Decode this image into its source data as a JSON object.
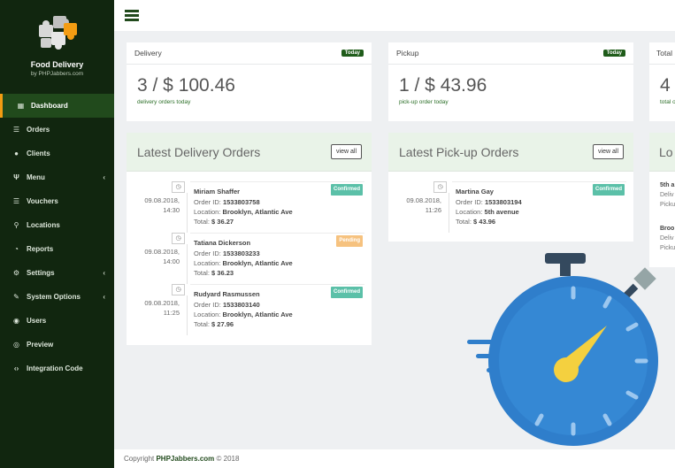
{
  "brand": {
    "title": "Food Delivery",
    "subtitle": "by PHPJabbers.com"
  },
  "nav": [
    {
      "label": "Dashboard",
      "icon": "dashboard-icon",
      "active": true
    },
    {
      "label": "Orders",
      "icon": "list-icon"
    },
    {
      "label": "Clients",
      "icon": "user-icon"
    },
    {
      "label": "Menu",
      "icon": "cutlery-icon",
      "chevron": true
    },
    {
      "label": "Vouchers",
      "icon": "list-icon"
    },
    {
      "label": "Locations",
      "icon": "map-marker-icon"
    },
    {
      "label": "Reports",
      "icon": "chart-icon"
    },
    {
      "label": "Settings",
      "icon": "gears-icon",
      "chevron": true
    },
    {
      "label": "System Options",
      "icon": "wrench-icon",
      "chevron": true
    },
    {
      "label": "Users",
      "icon": "users-icon"
    },
    {
      "label": "Preview",
      "icon": "eye-icon"
    },
    {
      "label": "Integration Code",
      "icon": "code-icon"
    }
  ],
  "stats": {
    "delivery": {
      "title": "Delivery",
      "badge": "Today",
      "value": "3 / $ 100.46",
      "sub": "delivery orders today"
    },
    "pickup": {
      "title": "Pickup",
      "badge": "Today",
      "value": "1 / $ 43.96",
      "sub": "pick-up order today"
    },
    "total": {
      "title": "Total",
      "value": "4",
      "sub": "total o"
    }
  },
  "delivery_panel": {
    "title": "Latest Delivery Orders",
    "view_all": "view all",
    "orders": [
      {
        "date": "09.08.2018,",
        "time": "14:30",
        "name": "Miriam Shaffer",
        "order_id_label": "Order ID:",
        "order_id": "1533803758",
        "location_label": "Location:",
        "location": "Brooklyn, Atlantic Ave",
        "total_label": "Total:",
        "total": "$ 36.27",
        "status": "Confirmed"
      },
      {
        "date": "09.08.2018,",
        "time": "14:00",
        "name": "Tatiana Dickerson",
        "order_id_label": "Order ID:",
        "order_id": "1533803233",
        "location_label": "Location:",
        "location": "Brooklyn, Atlantic Ave",
        "total_label": "Total:",
        "total": "$ 36.23",
        "status": "Pending"
      },
      {
        "date": "09.08.2018,",
        "time": "11:25",
        "name": "Rudyard Rasmussen",
        "order_id_label": "Order ID:",
        "order_id": "1533803140",
        "location_label": "Location:",
        "location": "Brooklyn, Atlantic Ave",
        "total_label": "Total:",
        "total": "$ 27.96",
        "status": "Confirmed"
      }
    ]
  },
  "pickup_panel": {
    "title": "Latest Pick-up Orders",
    "view_all": "view all",
    "orders": [
      {
        "date": "09.08.2018,",
        "time": "11:26",
        "name": "Martina Gay",
        "order_id_label": "Order ID:",
        "order_id": "1533803194",
        "location_label": "Location:",
        "location": "5th avenue",
        "total_label": "Total:",
        "total": "$ 43.96",
        "status": "Confirmed"
      }
    ]
  },
  "third_panel": {
    "title": "Lo",
    "items": [
      {
        "line1": "5th a",
        "line2": "Deliv",
        "line3": "Picku"
      },
      {
        "line1": "Broo",
        "line2": "Deliv",
        "line3": "Picku"
      }
    ]
  },
  "footer": {
    "prefix": "Copyright ",
    "brand": "PHPJabbers.com",
    "suffix": " © 2018"
  },
  "colors": {
    "sidebar": "#11260f",
    "accent": "#f39c12",
    "brand_green": "#214a1c",
    "stopwatch_blue": "#2f7ecb",
    "needle_yellow": "#f4d03f"
  }
}
